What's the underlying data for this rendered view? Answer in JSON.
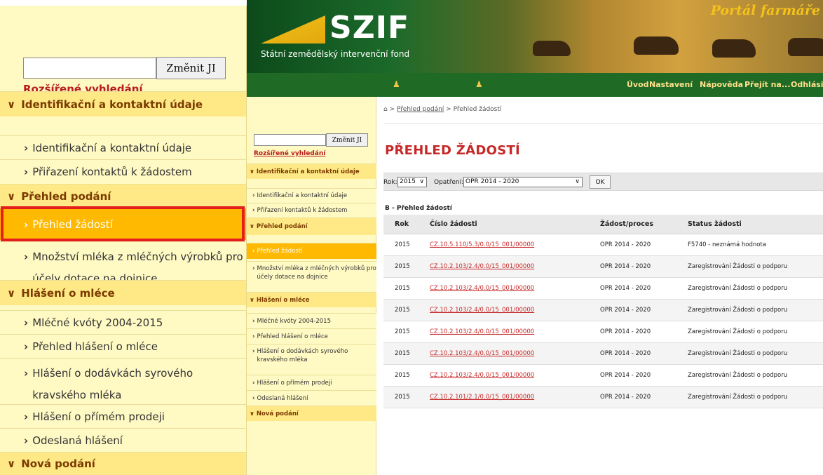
{
  "zoom": {
    "search_button": "Změnit JI",
    "advanced_search": "Rozšířené vyhledání",
    "menu": [
      {
        "label": "Identifikační a kontaktní údaje",
        "kind": "section"
      },
      {
        "label": "Identifikační a kontaktní údaje",
        "kind": "item"
      },
      {
        "label": "Přiřazení kontaktů k žádostem",
        "kind": "item"
      },
      {
        "label": "Přehled podání",
        "kind": "section"
      },
      {
        "label": "Přehled žádostí",
        "kind": "active"
      },
      {
        "label": "Množství mléka z mléčných výrobků pro účely dotace na dojnice",
        "kind": "item"
      },
      {
        "label": "Hlášení o mléce",
        "kind": "section"
      },
      {
        "label": "Mléčné kvóty 2004-2015",
        "kind": "item"
      },
      {
        "label": "Přehled hlášení o mléce",
        "kind": "item"
      },
      {
        "label": "Hlášení o dodávkách syrového kravského mléka",
        "kind": "item"
      },
      {
        "label": "Hlášení o přímém prodeji",
        "kind": "item"
      },
      {
        "label": "Odeslaná hlášení",
        "kind": "item"
      },
      {
        "label": "Nová podání",
        "kind": "section"
      }
    ]
  },
  "header": {
    "logo": "SZIF",
    "subtitle": "Státní zemědělský intervenční fond",
    "portal": "Portál farmáře"
  },
  "nav": {
    "links": [
      "Úvod",
      "Nastavení",
      "Nápověda",
      "Přejít na...",
      "Odhlásit"
    ]
  },
  "small_menu": {
    "search_button": "Změnit JI",
    "advanced_search": "Rozšířené vyhledání",
    "items": [
      {
        "label": "Identifikační a kontaktní údaje",
        "kind": "section"
      },
      {
        "label": "Identifikační a kontaktní údaje",
        "kind": "item"
      },
      {
        "label": "Přiřazení kontaktů k žádostem",
        "kind": "item"
      },
      {
        "label": "Přehled podání",
        "kind": "section"
      },
      {
        "label": "Přehled žádostí",
        "kind": "active"
      },
      {
        "label": "Množství mléka z mléčných výrobků pro účely dotace na dojnice",
        "kind": "item"
      },
      {
        "label": "Hlášení o mléce",
        "kind": "section"
      },
      {
        "label": "Mléčné kvóty 2004-2015",
        "kind": "item"
      },
      {
        "label": "Přehled hlášení o mléce",
        "kind": "item"
      },
      {
        "label": "Hlášení o dodávkách syrového kravského mléka",
        "kind": "item"
      },
      {
        "label": "Hlášení o přímém prodeji",
        "kind": "item"
      },
      {
        "label": "Odeslaná hlášení",
        "kind": "item"
      },
      {
        "label": "Nová podání",
        "kind": "section"
      }
    ]
  },
  "content": {
    "breadcrumb_sep": ">",
    "breadcrumb_link": "Přehled podání",
    "breadcrumb_current": "Přehled žádostí",
    "title": "PŘEHLED ŽÁDOSTÍ",
    "filter": {
      "year_label": "Rok:",
      "year_value": "2015",
      "measure_label": "Opatření:",
      "measure_value": "OPR 2014 - 2020",
      "ok": "OK"
    },
    "table_caption": "B - Přehled žádostí",
    "columns": [
      "Rok",
      "Číslo žádosti",
      "Žádost/proces",
      "Status žádosti"
    ],
    "rows": [
      [
        "2015",
        "CZ.10.5.110/5.3/0.0/15_001/00000",
        "OPR 2014 - 2020",
        "F5740 - neznámá hodnota"
      ],
      [
        "2015",
        "CZ.10.2.103/2.4/0.0/15_001/00000",
        "OPR 2014 - 2020",
        "Zaregistrování Žádosti o podporu"
      ],
      [
        "2015",
        "CZ.10.2.103/2.4/0.0/15_001/00000",
        "OPR 2014 - 2020",
        "Zaregistrování Žádosti o podporu"
      ],
      [
        "2015",
        "CZ.10.2.103/2.4/0.0/15_001/00000",
        "OPR 2014 - 2020",
        "Zaregistrování Žádosti o podporu"
      ],
      [
        "2015",
        "CZ.10.2.103/2.4/0.0/15_001/00000",
        "OPR 2014 - 2020",
        "Zaregistrování Žádosti o podporu"
      ],
      [
        "2015",
        "CZ.10.2.103/2.4/0.0/15_001/00000",
        "OPR 2014 - 2020",
        "Zaregistrování Žádosti o podporu"
      ],
      [
        "2015",
        "CZ.10.2.103/2.4/0.0/15_001/00000",
        "OPR 2014 - 2020",
        "Zaregistrování Žádosti o podporu"
      ],
      [
        "2015",
        "CZ.10.2.101/2.1/0.0/15_001/00000",
        "OPR 2014 - 2020",
        "Zaregistrování Žádosti o podporu"
      ]
    ]
  },
  "colors": {
    "accent_red": "#c62828",
    "menu_active": "#ffb900",
    "menu_bg": "#fff9c4",
    "section_bg": "#ffe986",
    "nav_green": "#1f6b26",
    "highlight_border": "#e41e1e"
  },
  "icons": {
    "nav_user": "user-icon",
    "nav_user2": "user-icon",
    "breadcrumb_home": "home-icon",
    "menu_arrow": "chevron-right-icon",
    "section_arrow": "chevron-down-icon"
  }
}
